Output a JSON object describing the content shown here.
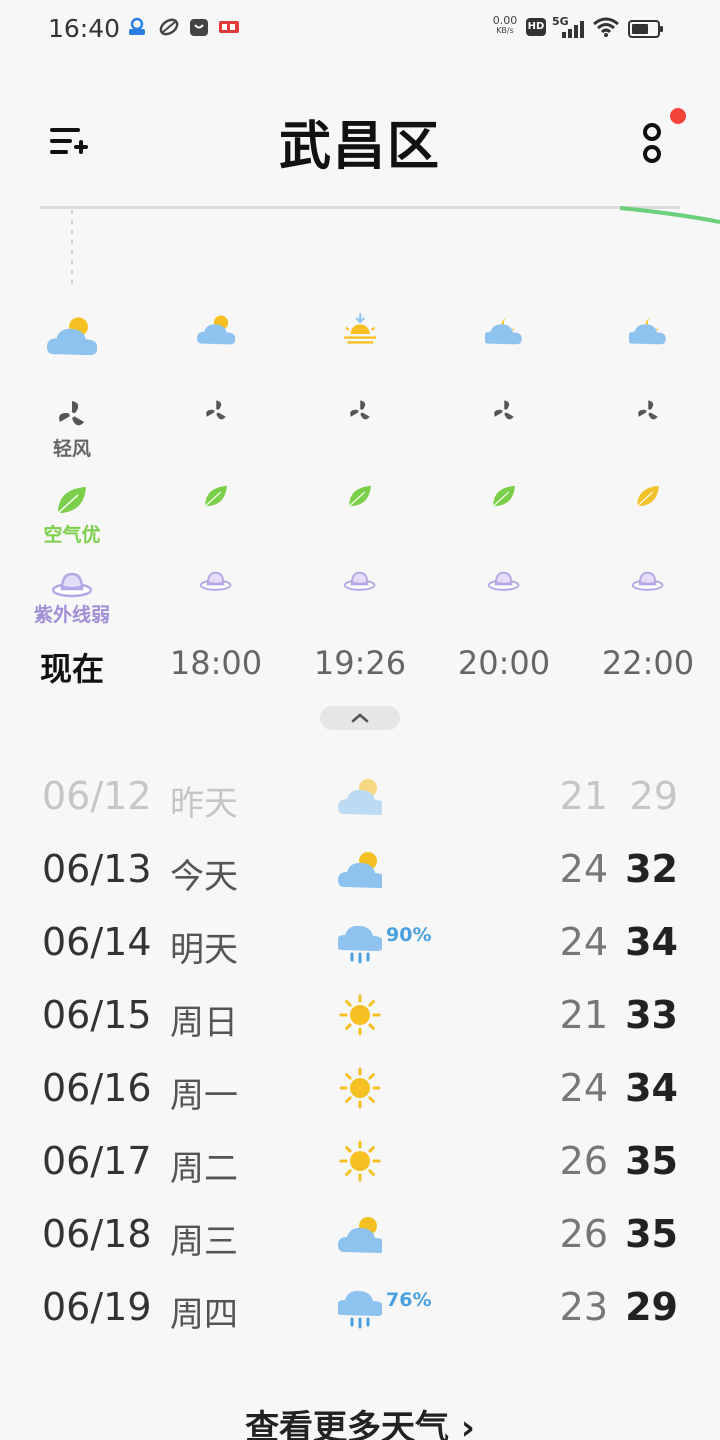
{
  "status_bar": {
    "time": "16:40",
    "net_speed_value": "0.00",
    "net_speed_unit": "KB/s",
    "hd_label": "HD",
    "network_label": "5G",
    "notification_icons": [
      "app-icon",
      "leaf-app-icon",
      "bag-icon",
      "toutiao-icon"
    ]
  },
  "header": {
    "city": "武昌区",
    "menu_icon": "list-add-icon",
    "more_icon": "more-circles-icon"
  },
  "hourly": [
    {
      "time": "现在",
      "weather_icon": "partly-cloudy-day-icon",
      "wind_icon": "fan-icon",
      "wind_label": "轻风",
      "air_icon": "leaf-icon",
      "air_label": "空气优",
      "air_color": "#7ccf4a",
      "uv_icon": "sun-hat-icon",
      "uv_label": "紫外线弱"
    },
    {
      "time": "18:00",
      "weather_icon": "partly-cloudy-day-icon",
      "wind_icon": "fan-icon",
      "wind_label": "",
      "air_icon": "leaf-icon",
      "air_label": "",
      "air_color": "#7ccf4a",
      "uv_icon": "sun-hat-icon",
      "uv_label": ""
    },
    {
      "time": "19:26",
      "weather_icon": "sunset-icon",
      "wind_icon": "fan-icon",
      "wind_label": "",
      "air_icon": "leaf-icon",
      "air_label": "",
      "air_color": "#7ccf4a",
      "uv_icon": "sun-hat-icon",
      "uv_label": ""
    },
    {
      "time": "20:00",
      "weather_icon": "partly-cloudy-night-icon",
      "wind_icon": "fan-icon",
      "wind_label": "",
      "air_icon": "leaf-icon",
      "air_label": "",
      "air_color": "#7ccf4a",
      "uv_icon": "sun-hat-icon",
      "uv_label": ""
    },
    {
      "time": "22:00",
      "weather_icon": "partly-cloudy-night-icon",
      "wind_icon": "fan-icon",
      "wind_label": "",
      "air_icon": "leaf-icon",
      "air_label": "",
      "air_color": "#f2c22c",
      "uv_icon": "sun-hat-icon",
      "uv_label": ""
    }
  ],
  "daily": [
    {
      "date": "06/12",
      "name": "昨天",
      "icon": "partly-cloudy-icon",
      "precip": "",
      "low": "21",
      "high": "29",
      "past": true
    },
    {
      "date": "06/13",
      "name": "今天",
      "icon": "partly-cloudy-icon",
      "precip": "",
      "low": "24",
      "high": "32",
      "past": false
    },
    {
      "date": "06/14",
      "name": "明天",
      "icon": "rain-icon",
      "precip": "90%",
      "low": "24",
      "high": "34",
      "past": false
    },
    {
      "date": "06/15",
      "name": "周日",
      "icon": "sunny-icon",
      "precip": "",
      "low": "21",
      "high": "33",
      "past": false
    },
    {
      "date": "06/16",
      "name": "周一",
      "icon": "sunny-icon",
      "precip": "",
      "low": "24",
      "high": "34",
      "past": false
    },
    {
      "date": "06/17",
      "name": "周二",
      "icon": "sunny-icon",
      "precip": "",
      "low": "26",
      "high": "35",
      "past": false
    },
    {
      "date": "06/18",
      "name": "周三",
      "icon": "partly-cloudy-icon",
      "precip": "",
      "low": "26",
      "high": "35",
      "past": false
    },
    {
      "date": "06/19",
      "name": "周四",
      "icon": "rain-icon",
      "precip": "76%",
      "low": "23",
      "high": "29",
      "past": false
    }
  ],
  "more_days_label": "查看更多天气 ›",
  "colors": {
    "sun": "#f5c021",
    "cloud": "#8ec3f0",
    "rain": "#4aa0de",
    "fan": "#555555",
    "hat": "#b6a8e6",
    "accent_dot": "#f2443b",
    "curve": "#6ccf7a"
  }
}
